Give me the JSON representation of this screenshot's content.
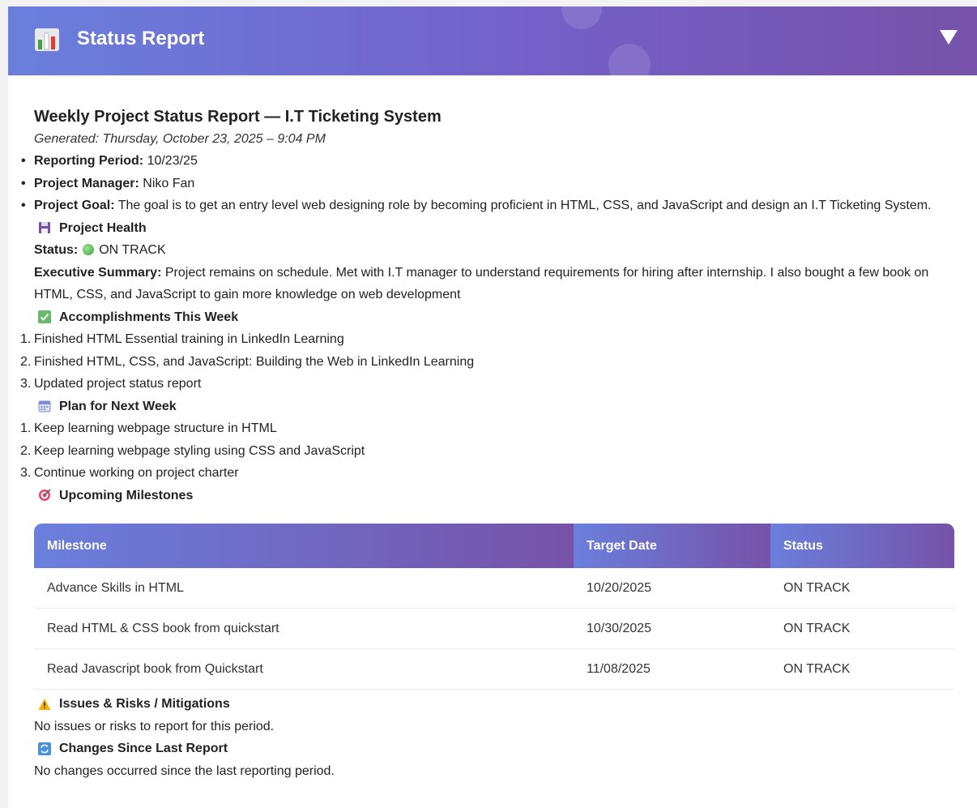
{
  "header": {
    "title": "Status Report",
    "icon": "bar-chart-icon",
    "collapse_icon": "triangle-down-icon"
  },
  "report": {
    "title": "Weekly Project Status Report — I.T Ticketing System",
    "generated": "Generated: Thursday, October 23, 2025 – 9:04 PM",
    "details": [
      {
        "label": "Reporting Period:",
        "value": "10/23/25"
      },
      {
        "label": "Project Manager:",
        "value": "Niko Fan"
      },
      {
        "label": "Project Goal:",
        "value": "The goal is to get an entry level web designing role by becoming proficient in HTML, CSS, and JavaScript and design an I.T Ticketing System."
      }
    ],
    "health": {
      "heading": "Project Health",
      "status_label": "Status:",
      "status_value": "ON TRACK",
      "summary_label": "Executive Summary:",
      "summary_text": "Project remains on schedule. Met with I.T manager to understand requirements for hiring after internship. I also bought a few book on HTML, CSS, and JavaScript to gain more knowledge on web development"
    },
    "accomplishments": {
      "heading": "Accomplishments This Week",
      "items": [
        "Finished HTML Essential training in LinkedIn Learning",
        "Finished HTML, CSS, and JavaScript: Building the Web in LinkedIn Learning",
        "Updated project status report"
      ]
    },
    "plan": {
      "heading": "Plan for Next Week",
      "items": [
        "Keep learning webpage structure in HTML",
        "Keep learning webpage styling using CSS and JavaScript",
        "Continue working on project charter"
      ]
    },
    "milestones": {
      "heading": "Upcoming Milestones",
      "columns": [
        "Milestone",
        "Target Date",
        "Status"
      ],
      "rows": [
        [
          "Advance Skills in HTML",
          "10/20/2025",
          "ON TRACK"
        ],
        [
          "Read HTML & CSS book from quickstart",
          "10/30/2025",
          "ON TRACK"
        ],
        [
          "Read Javascript book from Quickstart",
          "11/08/2025",
          "ON TRACK"
        ]
      ]
    },
    "issues": {
      "heading": "Issues & Risks / Mitigations",
      "text": "No issues or risks to report for this period."
    },
    "changes": {
      "heading": "Changes Since Last Report",
      "text": "No changes occurred since the last reporting period."
    }
  },
  "colors": {
    "header_gradient_start": "#6a7fdc",
    "header_gradient_end": "#7652a8",
    "status_green": "#3ea83a"
  }
}
